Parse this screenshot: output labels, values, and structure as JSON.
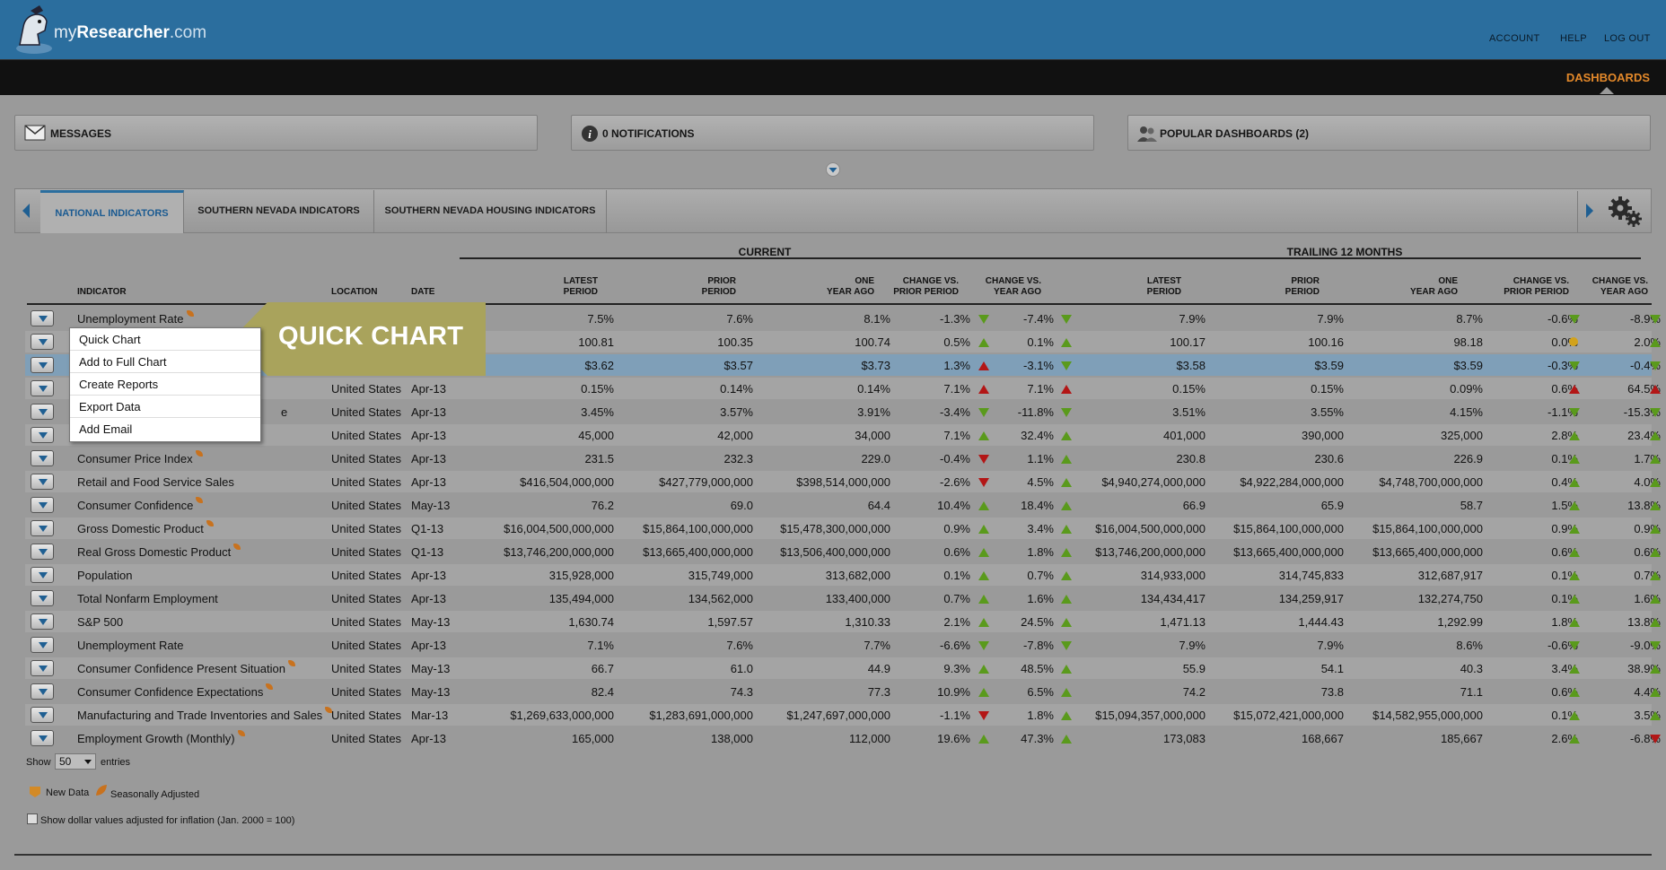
{
  "header": {
    "logo_name": "my",
    "logo_bold": "Researcher",
    "logo_suffix": ".com",
    "links": [
      "ACCOUNT",
      "HELP",
      "LOG OUT"
    ]
  },
  "nav": {
    "dashboards": "DASHBOARDS"
  },
  "panels": {
    "messages": "MESSAGES",
    "notifications": "0 NOTIFICATIONS",
    "popular": "POPULAR DASHBOARDS (2)"
  },
  "tabs": [
    "NATIONAL INDICATORS",
    "SOUTHERN NEVADA INDICATORS",
    "SOUTHERN NEVADA HOUSING INDICATORS"
  ],
  "table": {
    "group_current": "CURRENT",
    "group_trailing": "TRAILING 12 MONTHS",
    "headers": {
      "indicator": "INDICATOR",
      "location": "LOCATION",
      "date": "DATE",
      "latest_1": "LATEST",
      "latest_2": "PERIOD",
      "prior_1": "PRIOR",
      "prior_2": "PERIOD",
      "oneyr_1": "ONE",
      "oneyr_2": "YEAR AGO",
      "chgp_1": "CHANGE VS.",
      "chgp_2": "PRIOR PERIOD",
      "chgy_1": "CHANGE VS.",
      "chgy_2": "YEAR AGO"
    },
    "rows": [
      {
        "name": "Unemployment Rate",
        "sa": true,
        "loc": "",
        "date": "",
        "c": [
          "7.5%",
          "7.6%",
          "8.1%",
          "-1.3%",
          "-7.4%"
        ],
        "ca": [
          "down",
          "down"
        ],
        "t": [
          "7.9%",
          "7.9%",
          "8.7%",
          "-0.6%",
          "-8.9%"
        ],
        "ta": [
          "down",
          "down"
        ]
      },
      {
        "name": "",
        "sa": false,
        "loc": "",
        "date": "",
        "c": [
          "100.81",
          "100.35",
          "100.74",
          "0.5%",
          "0.1%"
        ],
        "ca": [
          "up",
          "up"
        ],
        "t": [
          "100.17",
          "100.16",
          "98.18",
          "0.0%",
          "2.0%"
        ],
        "ta": [
          "dot",
          "up"
        ]
      },
      {
        "name": "",
        "sa": false,
        "loc": "",
        "date": "",
        "c": [
          "$3.62",
          "$3.57",
          "$3.73",
          "1.3%",
          "-3.1%"
        ],
        "ca": [
          "redup",
          "down"
        ],
        "t": [
          "$3.58",
          "$3.59",
          "$3.59",
          "-0.3%",
          "-0.4%"
        ],
        "ta": [
          "down",
          "down"
        ]
      },
      {
        "name": "",
        "sa": false,
        "loc": "United States",
        "date": "Apr-13",
        "c": [
          "0.15%",
          "0.14%",
          "0.14%",
          "7.1%",
          "7.1%"
        ],
        "ca": [
          "redup",
          "redup"
        ],
        "t": [
          "0.15%",
          "0.15%",
          "0.09%",
          "0.6%",
          "64.5%"
        ],
        "ta": [
          "redup",
          "redup"
        ]
      },
      {
        "name": "e",
        "sa": false,
        "loc": "United States",
        "date": "Apr-13",
        "c": [
          "3.45%",
          "3.57%",
          "3.91%",
          "-3.4%",
          "-11.8%"
        ],
        "ca": [
          "down",
          "down"
        ],
        "t": [
          "3.51%",
          "3.55%",
          "4.15%",
          "-1.1%",
          "-15.3%"
        ],
        "ta": [
          "down",
          "down"
        ]
      },
      {
        "name": "",
        "sa": false,
        "loc": "United States",
        "date": "Apr-13",
        "c": [
          "45,000",
          "42,000",
          "34,000",
          "7.1%",
          "32.4%"
        ],
        "ca": [
          "up",
          "up"
        ],
        "t": [
          "401,000",
          "390,000",
          "325,000",
          "2.8%",
          "23.4%"
        ],
        "ta": [
          "up",
          "up"
        ]
      },
      {
        "name": "Consumer Price Index",
        "sa": true,
        "loc": "United States",
        "date": "Apr-13",
        "c": [
          "231.5",
          "232.3",
          "229.0",
          "-0.4%",
          "1.1%"
        ],
        "ca": [
          "reddown",
          "up"
        ],
        "t": [
          "230.8",
          "230.6",
          "226.9",
          "0.1%",
          "1.7%"
        ],
        "ta": [
          "up",
          "up"
        ]
      },
      {
        "name": "Retail and Food Service Sales",
        "sa": false,
        "loc": "United States",
        "date": "Apr-13",
        "c": [
          "$416,504,000,000",
          "$427,779,000,000",
          "$398,514,000,000",
          "-2.6%",
          "4.5%"
        ],
        "ca": [
          "reddown",
          "up"
        ],
        "t": [
          "$4,940,274,000,000",
          "$4,922,284,000,000",
          "$4,748,700,000,000",
          "0.4%",
          "4.0%"
        ],
        "ta": [
          "up",
          "up"
        ]
      },
      {
        "name": "Consumer Confidence",
        "sa": true,
        "loc": "United States",
        "date": "May-13",
        "c": [
          "76.2",
          "69.0",
          "64.4",
          "10.4%",
          "18.4%"
        ],
        "ca": [
          "up",
          "up"
        ],
        "t": [
          "66.9",
          "65.9",
          "58.7",
          "1.5%",
          "13.8%"
        ],
        "ta": [
          "up",
          "up"
        ]
      },
      {
        "name": "Gross Domestic Product",
        "sa": true,
        "loc": "United States",
        "date": "Q1-13",
        "c": [
          "$16,004,500,000,000",
          "$15,864,100,000,000",
          "$15,478,300,000,000",
          "0.9%",
          "3.4%"
        ],
        "ca": [
          "up",
          "up"
        ],
        "t": [
          "$16,004,500,000,000",
          "$15,864,100,000,000",
          "$15,864,100,000,000",
          "0.9%",
          "0.9%"
        ],
        "ta": [
          "up",
          "up"
        ]
      },
      {
        "name": "Real Gross Domestic Product",
        "sa": true,
        "loc": "United States",
        "date": "Q1-13",
        "c": [
          "$13,746,200,000,000",
          "$13,665,400,000,000",
          "$13,506,400,000,000",
          "0.6%",
          "1.8%"
        ],
        "ca": [
          "up",
          "up"
        ],
        "t": [
          "$13,746,200,000,000",
          "$13,665,400,000,000",
          "$13,665,400,000,000",
          "0.6%",
          "0.6%"
        ],
        "ta": [
          "up",
          "up"
        ]
      },
      {
        "name": "Population",
        "sa": false,
        "loc": "United States",
        "date": "Apr-13",
        "c": [
          "315,928,000",
          "315,749,000",
          "313,682,000",
          "0.1%",
          "0.7%"
        ],
        "ca": [
          "up",
          "up"
        ],
        "t": [
          "314,933,000",
          "314,745,833",
          "312,687,917",
          "0.1%",
          "0.7%"
        ],
        "ta": [
          "up",
          "up"
        ]
      },
      {
        "name": "Total Nonfarm Employment",
        "sa": false,
        "loc": "United States",
        "date": "Apr-13",
        "c": [
          "135,494,000",
          "134,562,000",
          "133,400,000",
          "0.7%",
          "1.6%"
        ],
        "ca": [
          "up",
          "up"
        ],
        "t": [
          "134,434,417",
          "134,259,917",
          "132,274,750",
          "0.1%",
          "1.6%"
        ],
        "ta": [
          "up",
          "up"
        ]
      },
      {
        "name": "S&P 500",
        "sa": false,
        "loc": "United States",
        "date": "May-13",
        "c": [
          "1,630.74",
          "1,597.57",
          "1,310.33",
          "2.1%",
          "24.5%"
        ],
        "ca": [
          "up",
          "up"
        ],
        "t": [
          "1,471.13",
          "1,444.43",
          "1,292.99",
          "1.8%",
          "13.8%"
        ],
        "ta": [
          "up",
          "up"
        ]
      },
      {
        "name": "Unemployment Rate",
        "sa": false,
        "loc": "United States",
        "date": "Apr-13",
        "c": [
          "7.1%",
          "7.6%",
          "7.7%",
          "-6.6%",
          "-7.8%"
        ],
        "ca": [
          "down",
          "down"
        ],
        "t": [
          "7.9%",
          "7.9%",
          "8.6%",
          "-0.6%",
          "-9.0%"
        ],
        "ta": [
          "down",
          "down"
        ]
      },
      {
        "name": "Consumer Confidence Present Situation",
        "sa": true,
        "loc": "United States",
        "date": "May-13",
        "c": [
          "66.7",
          "61.0",
          "44.9",
          "9.3%",
          "48.5%"
        ],
        "ca": [
          "up",
          "up"
        ],
        "t": [
          "55.9",
          "54.1",
          "40.3",
          "3.4%",
          "38.9%"
        ],
        "ta": [
          "up",
          "up"
        ]
      },
      {
        "name": "Consumer Confidence Expectations",
        "sa": true,
        "loc": "United States",
        "date": "May-13",
        "c": [
          "82.4",
          "74.3",
          "77.3",
          "10.9%",
          "6.5%"
        ],
        "ca": [
          "up",
          "up"
        ],
        "t": [
          "74.2",
          "73.8",
          "71.1",
          "0.6%",
          "4.4%"
        ],
        "ta": [
          "up",
          "up"
        ]
      },
      {
        "name": "Manufacturing and Trade Inventories and Sales",
        "sa": true,
        "loc": "United States",
        "date": "Mar-13",
        "c": [
          "$1,269,633,000,000",
          "$1,283,691,000,000",
          "$1,247,697,000,000",
          "-1.1%",
          "1.8%"
        ],
        "ca": [
          "reddown",
          "up"
        ],
        "t": [
          "$15,094,357,000,000",
          "$15,072,421,000,000",
          "$14,582,955,000,000",
          "0.1%",
          "3.5%"
        ],
        "ta": [
          "up",
          "up"
        ]
      },
      {
        "name": "Employment Growth (Monthly)",
        "sa": true,
        "loc": "United States",
        "date": "Apr-13",
        "c": [
          "165,000",
          "138,000",
          "112,000",
          "19.6%",
          "47.3%"
        ],
        "ca": [
          "up",
          "up"
        ],
        "t": [
          "173,083",
          "168,667",
          "185,667",
          "2.6%",
          "-6.8%"
        ],
        "ta": [
          "up",
          "reddown"
        ]
      }
    ]
  },
  "context_menu": [
    "Quick Chart",
    "Add to Full Chart",
    "Create Reports",
    "Export Data",
    "Add Email"
  ],
  "callout": "QUICK CHART",
  "footer": {
    "show": "Show",
    "show_value": "50",
    "entries": "entries",
    "new_data": "New Data",
    "seasonally_adjusted": "Seasonally Adjusted",
    "inflation": "Show dollar values adjusted for inflation (Jan. 2000 = 100)"
  },
  "colors": {
    "header_blue": "#2b6e9e",
    "accent_orange": "#e4892a",
    "up_green": "#5a9a1c",
    "down_red": "#b31616",
    "callout_olive": "#a9a35c"
  }
}
